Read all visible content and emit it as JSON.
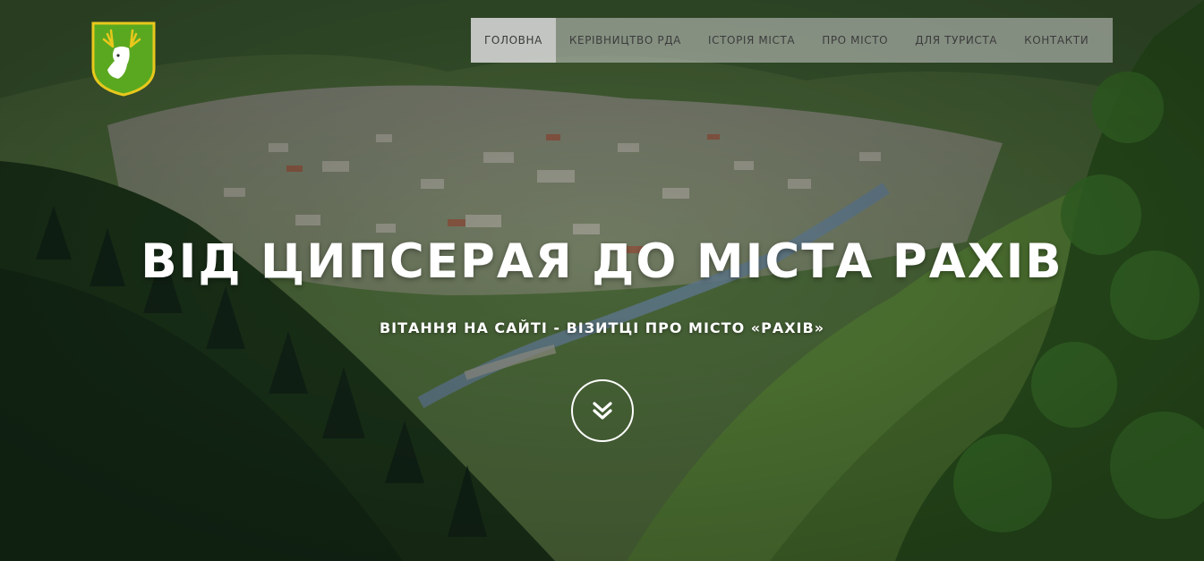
{
  "page": {
    "brand_color": "#5aa820"
  },
  "logo": {
    "icon": "deer-coat-of-arms-icon",
    "colors": {
      "shield": "#5aa820",
      "border": "#e8c81c",
      "deer": "#ffffff"
    }
  },
  "nav": {
    "items": [
      {
        "label": "ГОЛОВНА",
        "active": true
      },
      {
        "label": "КЕРІВНИЦТВО РДА",
        "active": false
      },
      {
        "label": "ІСТОРІЯ МІСТА",
        "active": false
      },
      {
        "label": "ПРО МІСТО",
        "active": false
      },
      {
        "label": "ДЛЯ ТУРИСТА",
        "active": false
      },
      {
        "label": "КОНТАКТИ",
        "active": false
      }
    ]
  },
  "hero": {
    "title": "ВІД ЦИПСЕРАЯ ДО МІСТА РАХІВ",
    "subtitle": "ВІТАННЯ НА САЙТІ - ВІЗИТЦІ ПРО МІСТО «РАХІВ»",
    "scroll_icon": "double-chevron-down-icon"
  }
}
